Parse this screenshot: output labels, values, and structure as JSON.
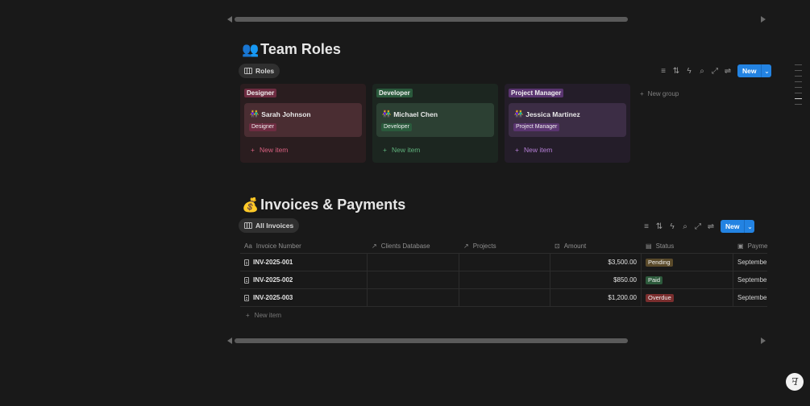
{
  "team_roles": {
    "emoji": "👥",
    "title": "Team Roles",
    "view_tab": "Roles",
    "toolbar": {
      "new_label": "New"
    },
    "new_group_label": "New group",
    "columns": [
      {
        "tag": "Designer",
        "card_name": "Sarah Johnson",
        "card_tag": "Designer",
        "new_item_label": "New item",
        "bg": "#2a1d1f",
        "tag_bg": "#6e2c41",
        "card_bg": "#4a2d32",
        "accent": "#d8607f"
      },
      {
        "tag": "Developer",
        "card_name": "Michael Chen",
        "card_tag": "Developer",
        "new_item_label": "New item",
        "bg": "#1c2620",
        "tag_bg": "#2a5a3c",
        "card_bg": "#2c4033",
        "accent": "#5fb07b"
      },
      {
        "tag": "Project Manager",
        "card_name": "Jessica Martinez",
        "card_tag": "Project Manager",
        "new_item_label": "New item",
        "bg": "#241d29",
        "tag_bg": "#5a3570",
        "card_bg": "#3c2d45",
        "accent": "#b57fd6"
      }
    ]
  },
  "invoices": {
    "emoji": "💰",
    "title": "Invoices & Payments",
    "view_tab": "All Invoices",
    "toolbar": {
      "new_label": "New"
    },
    "columns": [
      "Invoice Number",
      "Clients Database",
      "Projects",
      "Amount",
      "Status",
      "Payme"
    ],
    "rows": [
      {
        "number": "INV-2025-001",
        "client": "",
        "project": "",
        "amount": "$3,500.00",
        "status": "Pending",
        "status_bg": "#5a4a2a",
        "payment": "September"
      },
      {
        "number": "INV-2025-002",
        "client": "",
        "project": "",
        "amount": "$850.00",
        "status": "Paid",
        "status_bg": "#2d5a3c",
        "payment": "September"
      },
      {
        "number": "INV-2025-003",
        "client": "",
        "project": "",
        "amount": "$1,200.00",
        "status": "Overdue",
        "status_bg": "#7a2e2e",
        "payment": "September"
      }
    ],
    "new_item_label": "New item"
  },
  "icons": {
    "avatar": "two-people",
    "help": "ꟻ"
  }
}
